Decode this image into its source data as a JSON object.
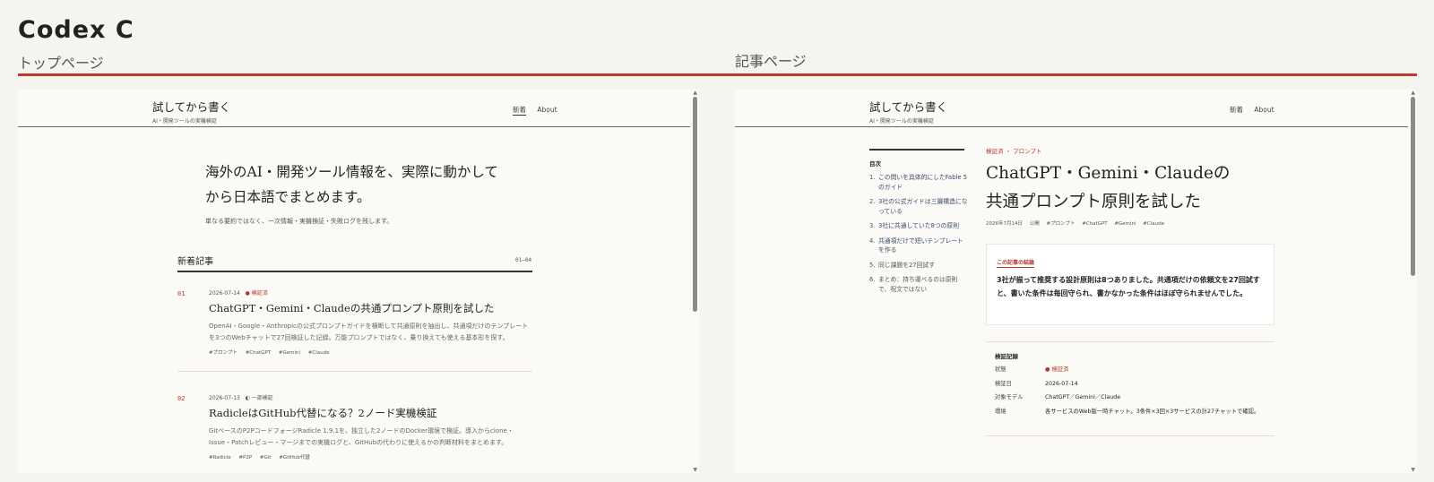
{
  "header": {
    "title": "Codex C",
    "left_label": "トップページ",
    "right_label": "記事ページ"
  },
  "colors": {
    "accent": "#c0392b",
    "background": "#f6f4ee",
    "panel": "#fbfaf6"
  },
  "site": {
    "name": "試してから書く",
    "tagline": "AI・開発ツールの実機検証",
    "nav_new": "新着",
    "nav_about": "About"
  },
  "top": {
    "hero_line1": "海外のAI・開発ツール情報を、実際に動かして",
    "hero_line2": "から日本語でまとめます。",
    "hero_sub": "単なる要約ではなく、一次情報・実機検証・失敗ログを残します。",
    "section_title": "新着記事",
    "section_range": "01–04",
    "articles": [
      {
        "num": "01",
        "date": "2026-07-14",
        "status_icon": "●",
        "status": "検証済",
        "title": "ChatGPT・Gemini・Claudeの共通プロンプト原則を試した",
        "desc": "OpenAI・Google・Anthropicの公式プロンプトガイドを横断して共通原則を抽出し、共通項だけのテンプレートを3つのWebチャットで27回検証した記録。万能プロンプトではなく、乗り換えても使える基本形を探す。",
        "tags": [
          "#プロンプト",
          "#ChatGPT",
          "#Gemini",
          "#Claude"
        ]
      },
      {
        "num": "02",
        "date": "2026-07-13",
        "status_icon": "◐",
        "status": "一部検証",
        "title": "RadicleはGitHub代替になる？2ノード実機検証",
        "desc": "GitベースのP2PコードフォージRadicle 1.9.1を、独立した2ノードのDocker環境で検証。導入からclone・Issue・Patchレビュー・マージまでの実機ログと、GitHubの代わりに使えるかの判断材料をまとめます。",
        "tags": [
          "#Radicle",
          "#P2P",
          "#Git",
          "#GitHub代替"
        ]
      }
    ]
  },
  "article": {
    "toc_title": "目次",
    "toc": [
      {
        "n": "1.",
        "text": "この問いを具体的にしたFable 5のガイド"
      },
      {
        "n": "2.",
        "text": "3社の公式ガイドは三層構造になっている"
      },
      {
        "n": "3.",
        "text": "3社に共通していた8つの原則"
      },
      {
        "n": "4.",
        "text": "共通項だけで短いテンプレートを作る"
      },
      {
        "n": "5.",
        "text": "同じ課題を27回試す"
      },
      {
        "n": "6.",
        "text": "まとめ：持ち運べるのは原則で、呪文ではない"
      }
    ],
    "crumbs": "検証済 ・ プロンプト",
    "title_line1": "ChatGPT・Gemini・Claudeの",
    "title_line2": "共通プロンプト原則を試した",
    "meta_date": "2026年7月14日",
    "meta_state": "公開",
    "meta_tags": [
      "#プロンプト",
      "#ChatGPT",
      "#Gemini",
      "#Claude"
    ],
    "summary_label": "この記事の結論",
    "summary_text": "3社が揃って推奨する設計原則は8つありました。共通項だけの依頼文を27回試すと、書いた条件は毎回守られ、書かなかった条件はほぼ守られませんでした。",
    "record_title": "検証記録",
    "record": [
      {
        "k": "状態",
        "v": "● 検証済"
      },
      {
        "k": "検証日",
        "v": "2026-07-14"
      },
      {
        "k": "対象モデル",
        "v": "ChatGPT／Gemini／Claude"
      },
      {
        "k": "環境",
        "v": "各サービスのWeb版一時チャット。3条件×3回×3サービスの計27チャットで確認。"
      }
    ]
  }
}
